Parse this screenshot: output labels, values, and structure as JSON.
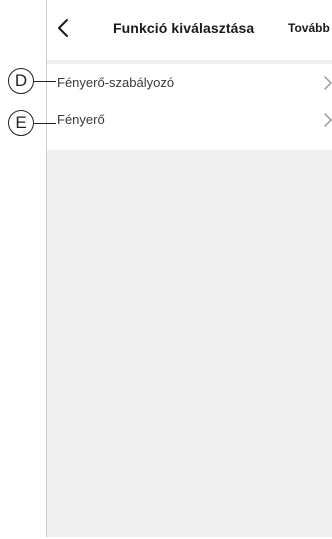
{
  "header": {
    "back_icon": "chevron-left-icon",
    "title": "Funkció kiválasztása",
    "next_label": "Tovább"
  },
  "functions": [
    {
      "label": "Fényerő-szabályozó",
      "icon": "chevron-right-icon"
    },
    {
      "label": "Fényerő",
      "icon": "chevron-right-icon"
    }
  ],
  "callouts": [
    "D",
    "E"
  ],
  "colors": {
    "screen_background": "#efefef",
    "header_background": "#ffffff",
    "text": "#1a1a1a",
    "row_text": "#3a3a3a",
    "chevron": "#9a9a9a"
  }
}
